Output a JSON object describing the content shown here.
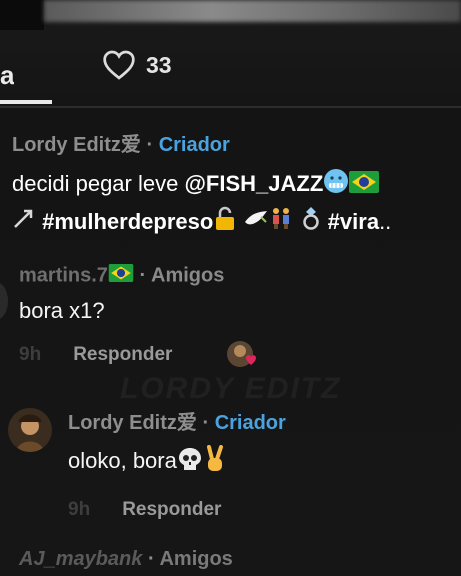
{
  "tabs": {
    "active_tab_partial": "a",
    "likes_count": "33"
  },
  "caption": {
    "username": "Lordy Editz爱",
    "role_separator": "·",
    "role": "Criador",
    "line1_text": "decidi pegar leve",
    "line1_mention": "@FISH_JAZZ",
    "line2_hashtag1": "#mulherdepreso",
    "line2_hashtag2": "#vira",
    "line2_ellipsis": ".."
  },
  "comments": [
    {
      "username": "martins.7",
      "role_separator": "·",
      "role": "Amigos",
      "text": "bora x1?",
      "time": "9h",
      "reply_label": "Responder"
    },
    {
      "username": "Lordy Editz爱",
      "role_separator": "·",
      "role": "Criador",
      "text": "oloko, bora",
      "time": "9h",
      "reply_label": "Responder"
    },
    {
      "username": "AJ_maybank",
      "role_separator": "·",
      "role": "Amigos"
    }
  ],
  "watermark_text": "LORDY EDITZ",
  "colors": {
    "creator_blue": "#4aa3df",
    "background": "#141414",
    "meta_gray": "#8e8e8e"
  },
  "icons": [
    "heart-outline-icon",
    "brazil-flag-icon",
    "cold-face-emoji",
    "lock-emoji",
    "dove-emoji",
    "people-emoji",
    "ring-emoji",
    "skull-emoji",
    "victory-hand-emoji",
    "red-heart-emoji"
  ]
}
